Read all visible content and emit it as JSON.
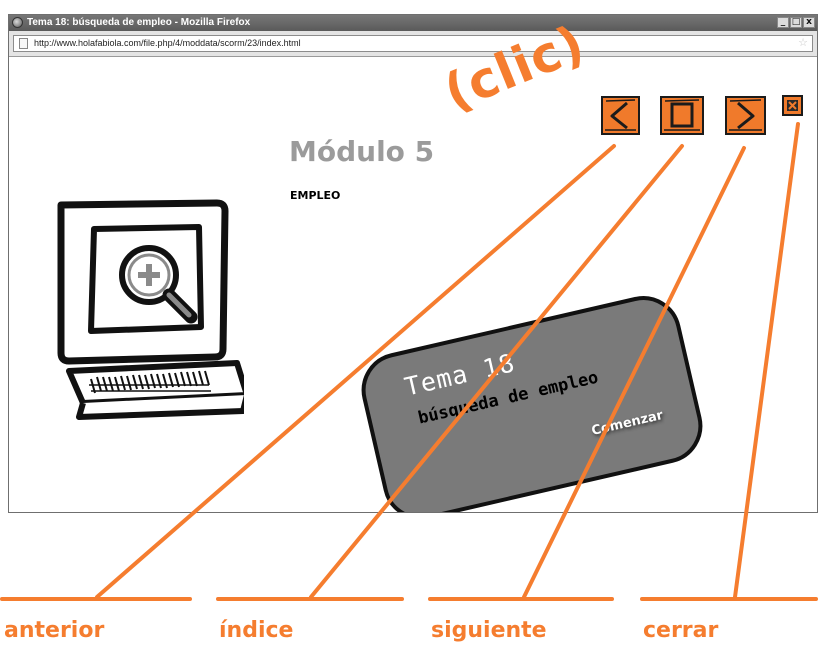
{
  "window": {
    "title": "Tema 18: búsqueda de empleo - Mozilla Firefox",
    "minimize": "_",
    "maximize": "□",
    "close": "x"
  },
  "addressbar": {
    "url": "http://www.holafabiola.com/file.php/4/moddata/scorm/23/index.html"
  },
  "content": {
    "module_title": "Módulo 5",
    "module_subtitle": "EMPLEO",
    "tema_title": "Tema 18",
    "tema_subtitle": "búsqueda de empleo",
    "start_button": "Comenzar"
  },
  "annotation": {
    "clic": "(clic)",
    "labels": {
      "previous": "anterior",
      "index": "índice",
      "next": "siguiente",
      "close": "cerrar"
    }
  },
  "icons": {
    "previous": "chevron-left-icon",
    "index": "square-icon",
    "next": "chevron-right-icon",
    "close": "close-icon",
    "magnifier": "zoom-in-icon"
  },
  "colors": {
    "accent_orange": "#f57d2f",
    "button_orange": "#f07a2b",
    "card_gray": "#7a7a7a",
    "heading_gray": "#9b9b9b"
  }
}
